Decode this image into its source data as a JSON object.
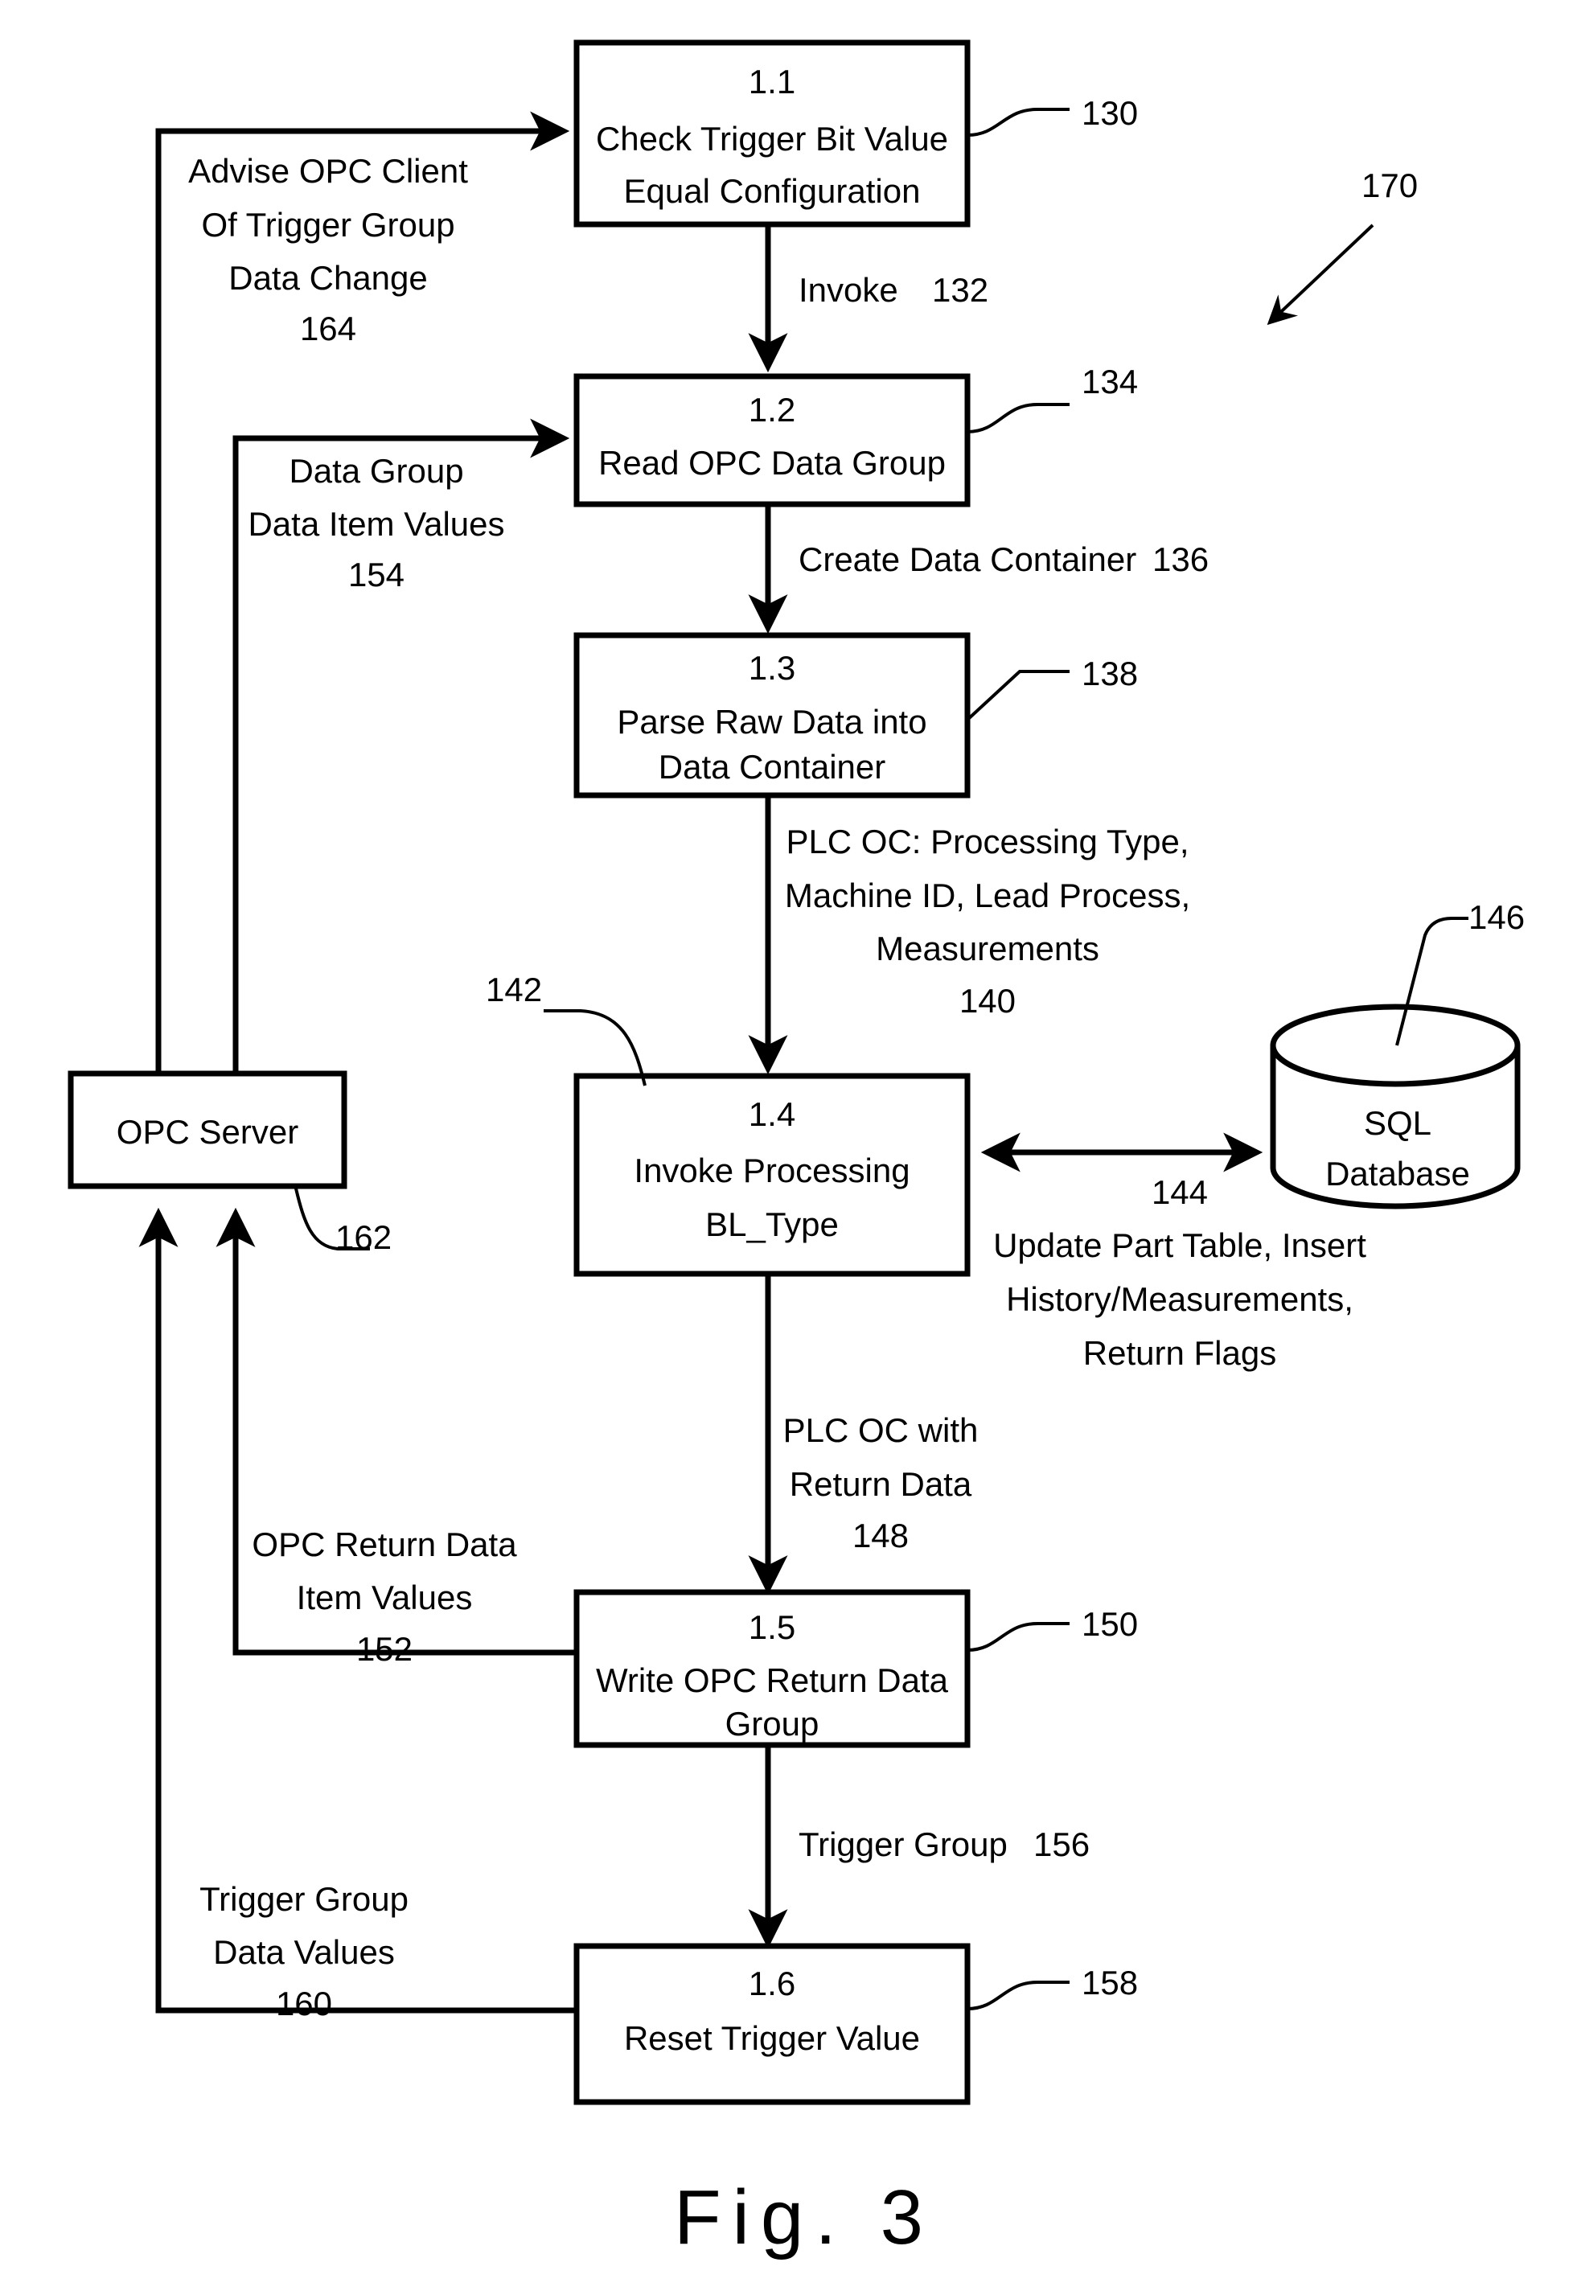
{
  "figure": {
    "caption": "Fig.  3",
    "system_ref": "170"
  },
  "process_boxes": [
    {
      "id": "1.1",
      "number": "1.1",
      "line1": "Check Trigger Bit Value",
      "line2": "Equal Configuration",
      "ref": "130"
    },
    {
      "id": "1.2",
      "number": "1.2",
      "line1": "Read OPC Data Group",
      "line2": "",
      "ref": "134"
    },
    {
      "id": "1.3",
      "number": "1.3",
      "line1": "Parse Raw Data into",
      "line2": "Data Container",
      "ref": "138"
    },
    {
      "id": "1.4",
      "number": "1.4",
      "line1": "Invoke Processing",
      "line2": "BL_Type",
      "ref": "142"
    },
    {
      "id": "1.5",
      "number": "1.5",
      "line1": "Write OPC Return Data",
      "line2": "Group",
      "ref": "150"
    },
    {
      "id": "1.6",
      "number": "1.6",
      "line1": "Reset Trigger Value",
      "line2": "",
      "ref": "158"
    }
  ],
  "entities": {
    "opc_server": {
      "label": "OPC Server",
      "ref": "162"
    },
    "sql_database": {
      "line1": "SQL",
      "line2": "Database",
      "ref": "146"
    }
  },
  "flow_labels": {
    "invoke": {
      "text": "Invoke",
      "ref": "132"
    },
    "create_data_container": {
      "text": "Create Data Container",
      "ref": "136"
    },
    "plc_oc_in": {
      "line1": "PLC OC: Processing Type,",
      "line2": "Machine ID, Lead Process,",
      "line3": "Measurements",
      "ref": "140"
    },
    "sql_exchange": {
      "ref": "144",
      "line1": "Update Part Table, Insert",
      "line2": "History/Measurements,",
      "line3": "Return Flags"
    },
    "plc_oc_return": {
      "line1": "PLC OC with",
      "line2": "Return Data",
      "ref": "148"
    },
    "trigger_group": {
      "text": "Trigger Group",
      "ref": "156"
    },
    "advise_opc_client": {
      "line1": "Advise OPC Client",
      "line2": "Of Trigger Group",
      "line3": "Data Change",
      "ref": "164"
    },
    "data_group_values": {
      "line1": "Data Group",
      "line2": "Data Item Values",
      "ref": "154"
    },
    "opc_return_values": {
      "line1": "OPC Return Data",
      "line2": "Item Values",
      "ref": "152"
    },
    "trigger_group_values": {
      "line1": "Trigger Group",
      "line2": "Data Values",
      "ref": "160"
    }
  },
  "colors": {
    "ink": "#000000",
    "paper": "#ffffff"
  }
}
